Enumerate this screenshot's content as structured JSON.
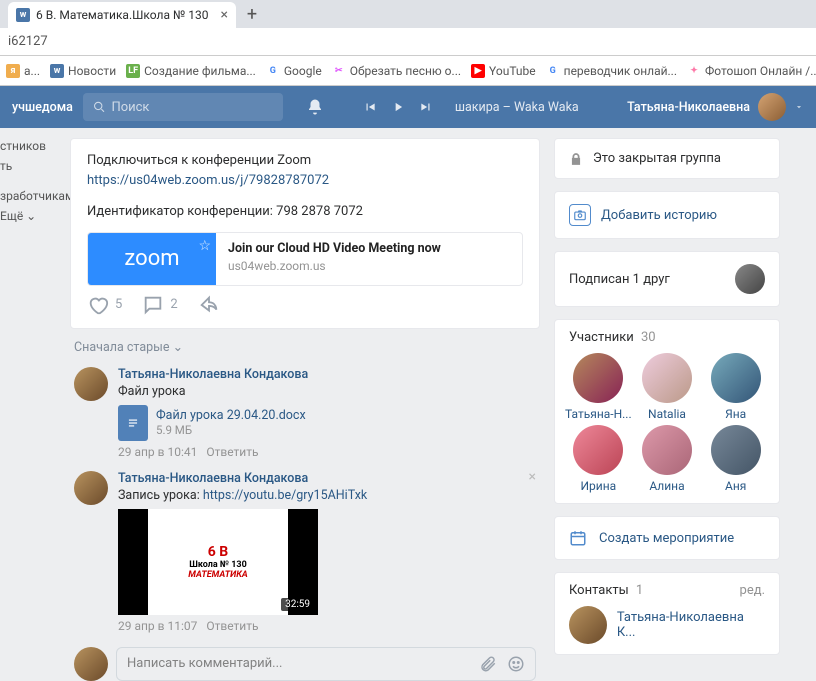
{
  "browser": {
    "tab_title": "6 В. Математика.Школа № 130",
    "url_fragment": "i62127",
    "bookmarks": [
      {
        "label": "a...",
        "color": "#f0ad4e"
      },
      {
        "label": "Новости",
        "color": "#4a76a8",
        "glyph": "w"
      },
      {
        "label": "Создание фильма...",
        "color": "#6ab04c",
        "glyph": "LF"
      },
      {
        "label": "Google",
        "color": "",
        "glyph": "G"
      },
      {
        "label": "Обрезать песню о...",
        "color": "#e056fd",
        "glyph": "✂"
      },
      {
        "label": "YouTube",
        "color": "#ff0000",
        "glyph": "▶"
      },
      {
        "label": "переводчик онлай...",
        "color": "",
        "glyph": "G"
      },
      {
        "label": "Фотошоп Онлайн /...",
        "color": "#fd79a8",
        "glyph": "✦"
      }
    ]
  },
  "header": {
    "hashtag": "учшедома",
    "search_placeholder": "Поиск",
    "track": "шакира – Waka Waka",
    "username": "Татьяна-Николаевна"
  },
  "left_nav": [
    "стников",
    "ть",
    "",
    "зработчикам",
    "Ещё ⌄"
  ],
  "post": {
    "line1": "Подключиться к конференции Zoom",
    "link1": "https://us04web.zoom.us/j/79828787072",
    "line2": "Идентификатор конференции: 798 2878 7072",
    "linkcard": {
      "title": "Join our Cloud HD Video Meeting now",
      "sub": "us04web.zoom.us",
      "brand": "zoom"
    },
    "likes": "5",
    "comments_count": "2"
  },
  "sort": "Сначала старые ⌄",
  "comments": [
    {
      "author": "Татьяна-Николаевна Кондакова",
      "text": "Файл урока",
      "file": {
        "name": "Файл урока 29.04.20.docx",
        "size": "5.9 МБ"
      },
      "meta": "29 апр в 10:41",
      "reply": "Ответить"
    },
    {
      "author": "Татьяна-Николаевна Кондакова",
      "text_prefix": "Запись урока: ",
      "text_link": "https://youtu.be/gry15AHiTxk",
      "video": {
        "t1": "6 В",
        "t2": "Школа № 130",
        "t3": "МАТЕМАТИКА",
        "dur": "32:59"
      },
      "meta": "29 апр в 11:07",
      "reply": "Ответить"
    }
  ],
  "comment_input": "Написать комментарий...",
  "right": {
    "closed": "Это закрытая группа",
    "add_story": "Добавить историю",
    "subscribed": "Подписан 1 друг",
    "members_title": "Участники",
    "members_count": "30",
    "members": [
      "Татьяна-Н...",
      "Natalia",
      "Яна",
      "Ирина",
      "Алина",
      "Аня"
    ],
    "create_event": "Создать мероприятие",
    "contacts_title": "Контакты",
    "contacts_count": "1",
    "contacts_edit": "ред.",
    "contact_name": "Татьяна-Николаевна К..."
  }
}
